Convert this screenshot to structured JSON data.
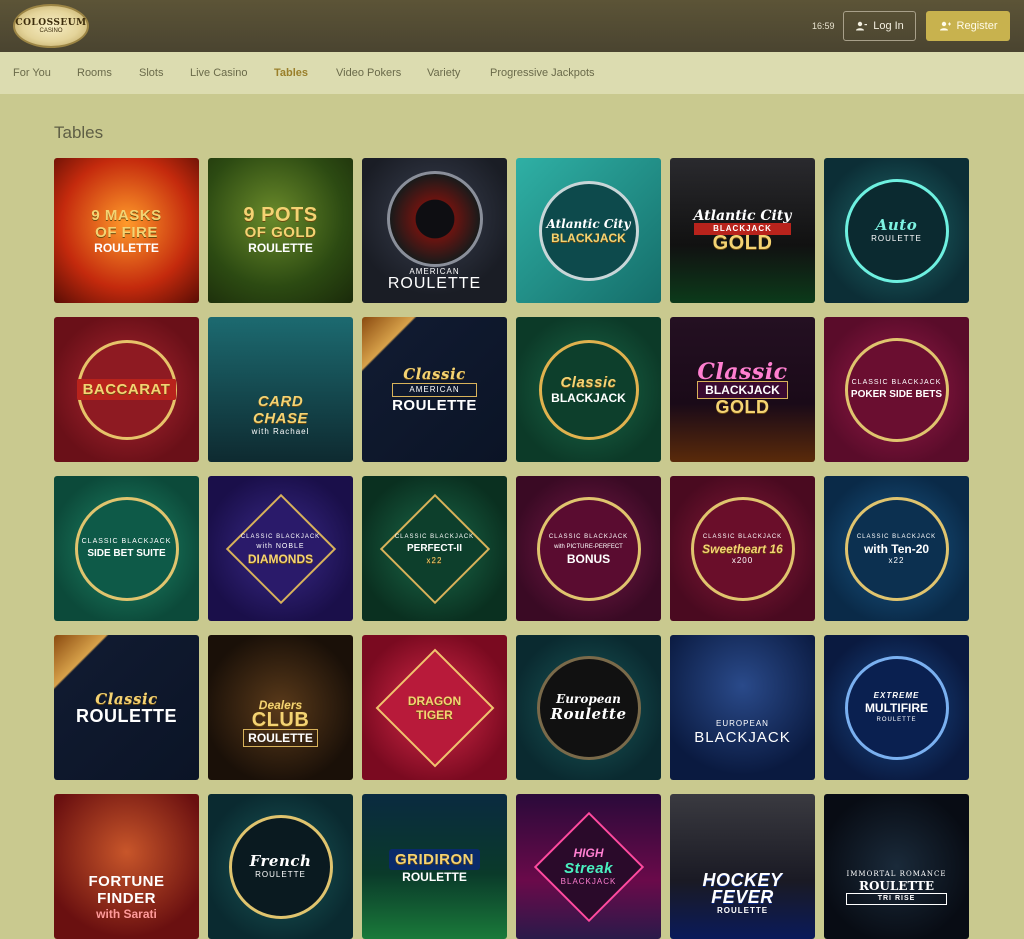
{
  "header": {
    "logo_text": "COLOSSEUM",
    "logo_sub": "CASINO",
    "time": "16:59",
    "login_label": "Log In",
    "register_label": "Register"
  },
  "nav": {
    "items": [
      "For You",
      "Rooms",
      "Slots",
      "Live Casino",
      "Tables",
      "Video Pokers",
      "Variety",
      "Progressive Jackpots"
    ],
    "active": "Tables"
  },
  "section_title": "Tables",
  "games": [
    {
      "l1": "9 MASKS",
      "l2": "OF FIRE",
      "l3": "ROULETTE"
    },
    {
      "l1": "9 POTS",
      "l2": "OF GOLD",
      "l3": "ROULETTE"
    },
    {
      "l1": "AMERICAN",
      "l2": "",
      "l3": "ROULETTE"
    },
    {
      "l1": "Atlantic City",
      "l2": "BLACKJACK",
      "l3": ""
    },
    {
      "l1": "Atlantic City",
      "l2": "BLACKJACK",
      "l3": "GOLD"
    },
    {
      "l1": "Auto",
      "l2": "ROULETTE",
      "l3": ""
    },
    {
      "l1": "BACCARAT",
      "l2": "",
      "l3": ""
    },
    {
      "l1": "CARD",
      "l2": "CHASE",
      "l3": "with Rachael"
    },
    {
      "l1": "Classic",
      "l2": "AMERICAN",
      "l3": "ROULETTE"
    },
    {
      "l1": "Classic",
      "l2": "BLACKJACK",
      "l3": ""
    },
    {
      "l1": "Classic",
      "l2": "BLACKJACK",
      "l3": "GOLD"
    },
    {
      "l1": "CLASSIC BLACKJACK",
      "l2": "POKER SIDE BETS",
      "l3": ""
    },
    {
      "l1": "CLASSIC BLACKJACK",
      "l2": "SIDE BET SUITE",
      "l3": ""
    },
    {
      "l1": "CLASSIC BLACKJACK",
      "l2": "with NOBLE",
      "l3": "DIAMONDS"
    },
    {
      "l1": "CLASSIC BLACKJACK",
      "l2": "PERFECT-II",
      "l3": "x22"
    },
    {
      "l1": "CLASSIC BLACKJACK",
      "l2": "with PICTURE-PERFECT",
      "l3": "BONUS"
    },
    {
      "l1": "CLASSIC BLACKJACK",
      "l2": "Sweetheart 16",
      "l3": "x200"
    },
    {
      "l1": "CLASSIC BLACKJACK",
      "l2": "with Ten-20",
      "l3": "x22"
    },
    {
      "l1": "Classic",
      "l2": "ROULETTE",
      "l3": ""
    },
    {
      "l1": "Dealers",
      "l2": "CLUB",
      "l3": "ROULETTE"
    },
    {
      "l1": "DRAGON",
      "l2": "TIGER",
      "l3": ""
    },
    {
      "l1": "European",
      "l2": "Roulette",
      "l3": ""
    },
    {
      "l1": "EUROPEAN",
      "l2": "BLACKJACK",
      "l3": ""
    },
    {
      "l1": "EXTREME",
      "l2": "MULTIFIRE",
      "l3": "ROULETTE"
    },
    {
      "l1": "FORTUNE",
      "l2": "FINDER",
      "l3": "with Sarati"
    },
    {
      "l1": "French",
      "l2": "ROULETTE",
      "l3": ""
    },
    {
      "l1": "GRIDIRON",
      "l2": "ROULETTE",
      "l3": ""
    },
    {
      "l1": "HIGH",
      "l2": "Streak",
      "l3": "BLACKJACK"
    },
    {
      "l1": "HOCKEY",
      "l2": "FEVER",
      "l3": "ROULETTE"
    },
    {
      "l1": "IMMORTAL ROMANCE",
      "l2": "ROULETTE",
      "l3": "TRI RISE"
    }
  ],
  "colors": {
    "page_bg": "#c9c98f",
    "header_bg": "#4a4430",
    "nav_bg": "#dcdcb0",
    "accent": "#c8b24e",
    "active_nav": "#9a7f2a"
  }
}
